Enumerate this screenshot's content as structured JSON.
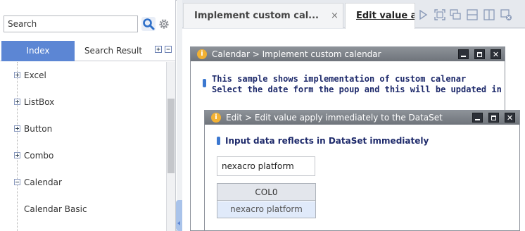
{
  "search": {
    "value": "Search"
  },
  "left_tabs": {
    "index": "Index",
    "search_result": "Search Result"
  },
  "tree": {
    "items": [
      {
        "label": "Excel",
        "expanded": false
      },
      {
        "label": "ListBox",
        "expanded": false
      },
      {
        "label": "Button",
        "expanded": false
      },
      {
        "label": "Combo",
        "expanded": false
      },
      {
        "label": "Calendar",
        "expanded": true
      }
    ],
    "children": [
      "Calendar Basic"
    ]
  },
  "doc_tabs": [
    {
      "title": "Implement custom cal...",
      "close": "×"
    },
    {
      "title": "Edit value apply immediately to the DataSet"
    }
  ],
  "window1": {
    "title": "Calendar > Implement custom calendar",
    "desc_line1": "This sample shows implementation of custom calenar",
    "desc_line2": "Select the date form the poup and this will be updated in the Grid"
  },
  "window2": {
    "title": "Edit > Edit value apply immediately to the DataSet",
    "desc": "Input data reflects in DataSet immediately",
    "edit_value": "nexacro platform",
    "grid": {
      "columns": [
        "COL0"
      ],
      "rows": [
        [
          "nexacro platform"
        ]
      ]
    }
  },
  "colors": {
    "accent": "#5c86d4",
    "window_title": "#7a7f86",
    "desc_text": "#1e2a6b",
    "grid_selected": "#e0eafa",
    "marker": "#3c78d0"
  }
}
